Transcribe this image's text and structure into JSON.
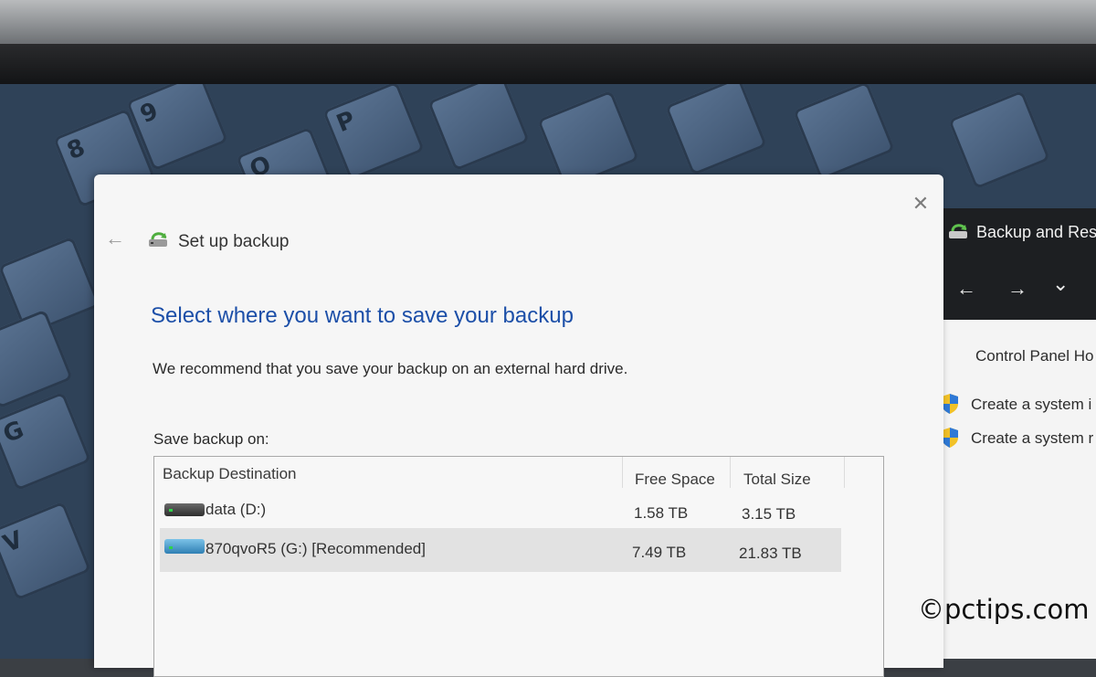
{
  "dialog": {
    "close_icon": "close-icon",
    "back_icon": "back-arrow-icon",
    "header_icon": "backup-restore-icon",
    "title": "Set up backup",
    "heading": "Select where you want to save your backup",
    "recommendation": "We recommend that you save your backup on an external hard drive.",
    "save_on_label": "Save backup on:",
    "table": {
      "columns": [
        "Backup Destination",
        "Free Space",
        "Total Size"
      ],
      "rows": [
        {
          "destination": "data (D:)",
          "free_space": "1.58 TB",
          "total_size": "3.15 TB",
          "selected": false,
          "icon": "hard-drive-icon"
        },
        {
          "destination": "870qvoR5 (G:) [Recommended]",
          "free_space": "7.49 TB",
          "total_size": "21.83 TB",
          "selected": true,
          "icon": "external-drive-icon"
        }
      ]
    }
  },
  "backup_restore_window": {
    "title": "Backup and Res",
    "nav": {
      "back": "←",
      "forward": "→",
      "dropdown": "⌄"
    },
    "control_panel_link": "Control Panel Ho",
    "tasks": [
      {
        "label": "Create a system i",
        "icon": "uac-shield-icon"
      },
      {
        "label": "Create a system r",
        "icon": "uac-shield-icon"
      }
    ]
  },
  "wallpaper_keys": [
    "9",
    "P",
    "8",
    "O",
    "G",
    "V"
  ],
  "watermark": "©pctips.com",
  "colors": {
    "heading_blue": "#1c4fa8",
    "selected_row": "#e2e2e2",
    "titlebar_dark": "#1d1f22"
  }
}
